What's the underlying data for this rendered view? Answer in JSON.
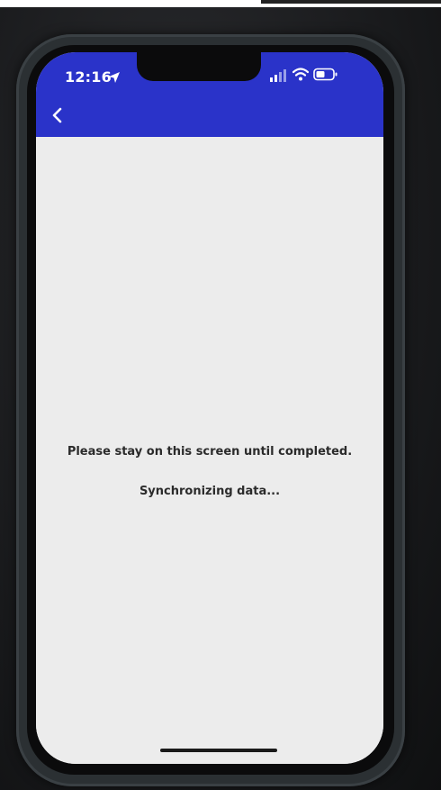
{
  "status_bar": {
    "time": "12:16",
    "icons": [
      "location-arrow-icon",
      "signal-icon",
      "wifi-icon",
      "battery-icon"
    ]
  },
  "header": {
    "background_color": "#2a33c9",
    "back_icon": "chevron-left-icon"
  },
  "main": {
    "message_primary": "Please stay on this screen until completed.",
    "message_status": "Synchronizing data..."
  },
  "colors": {
    "screen_background": "#ececec",
    "text": "#2b2b2b"
  }
}
